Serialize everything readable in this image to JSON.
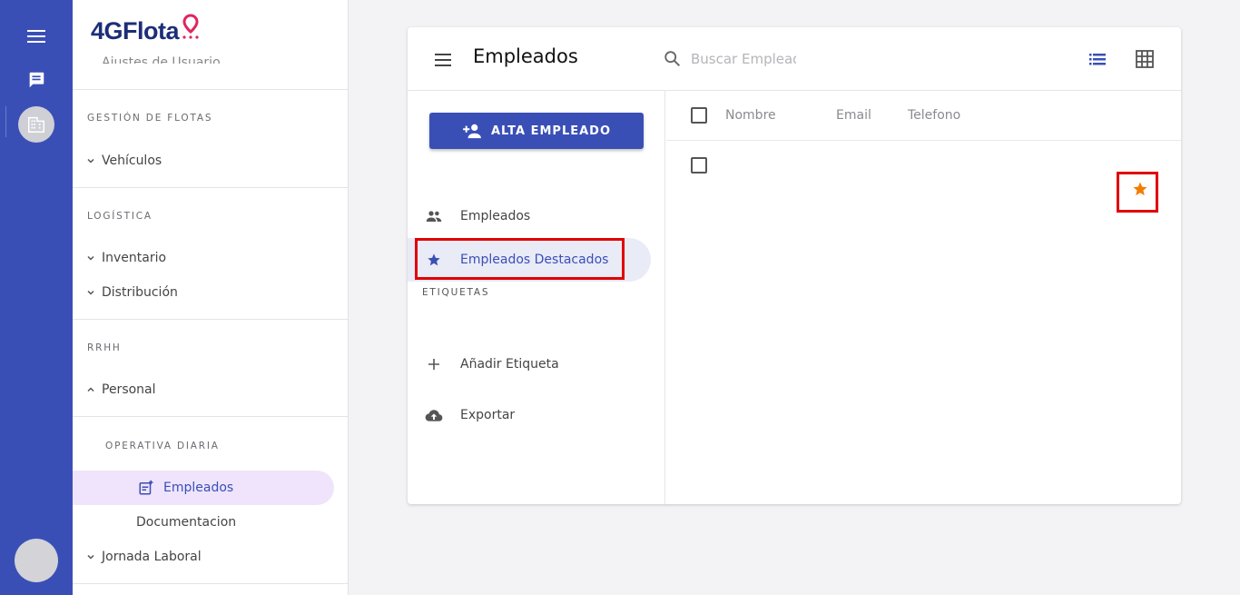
{
  "brand": {
    "logo_text": "4GFlota",
    "accent": "#3a4fb6",
    "logo_pin_color": "#e0245e"
  },
  "rail": {
    "menu_icon": "menu-icon",
    "chat_icon": "chat-icon",
    "org_icon": "building-icon"
  },
  "sidebar": {
    "cut_item": "Ajustes de Usuario",
    "sections": [
      {
        "label": "GESTIÓN DE FLOTAS",
        "items": [
          {
            "label": "Vehículos",
            "state": "collapsed"
          }
        ]
      },
      {
        "label": "LOGÍSTICA",
        "items": [
          {
            "label": "Inventario",
            "state": "collapsed"
          },
          {
            "label": "Distribución",
            "state": "collapsed"
          }
        ]
      },
      {
        "label": "RRHH",
        "items": [
          {
            "label": "Personal",
            "state": "expanded"
          }
        ]
      }
    ],
    "subsection_label": "OPERATIVA DIARIA",
    "sub_items": [
      {
        "label": "Empleados",
        "active": true
      },
      {
        "label": "Documentacion",
        "active": false
      }
    ],
    "after_items": [
      {
        "label": "Jornada Laboral",
        "state": "collapsed"
      }
    ]
  },
  "main": {
    "title": "Empleados",
    "search": {
      "placeholder": "Buscar Empleado",
      "value": ""
    },
    "view_icons": [
      "list-view-icon",
      "grid-view-icon"
    ],
    "add_button_label": "ALTA EMPLEADO",
    "nav": [
      {
        "label": "Empleados",
        "icon": "people-icon",
        "active": false
      },
      {
        "label": "Empleados Destacados",
        "icon": "star-icon",
        "active": true
      }
    ],
    "tags_label": "ETIQUETAS",
    "actions": [
      {
        "label": "Añadir Etiqueta",
        "icon": "plus-icon"
      },
      {
        "label": "Exportar",
        "icon": "cloud-upload-icon"
      }
    ],
    "table": {
      "columns": [
        "Nombre",
        "Email",
        "Telefono"
      ],
      "rows": [
        {
          "name": "",
          "email": "",
          "phone": "",
          "starred": true
        }
      ]
    },
    "star_color": "#f57c00",
    "highlight_color": "#e00000"
  }
}
